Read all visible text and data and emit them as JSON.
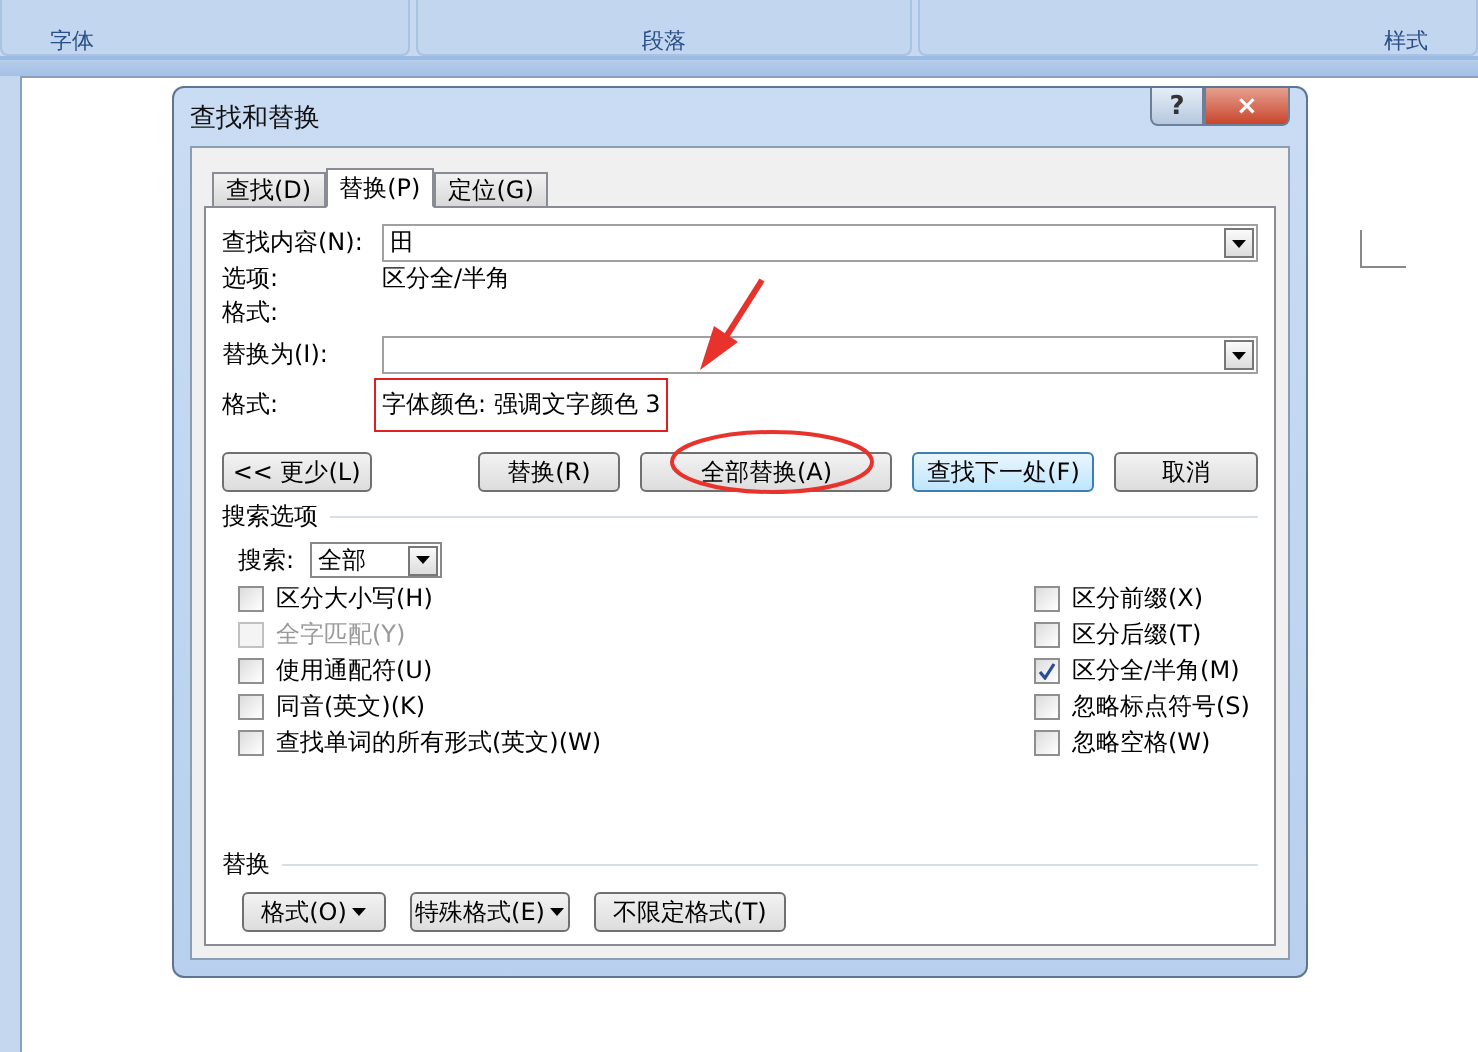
{
  "ribbon": {
    "groups": [
      "字体",
      "段落",
      "样式"
    ]
  },
  "dialog": {
    "title": "查找和替换",
    "help_button": "?",
    "close_button": "×",
    "tabs": [
      {
        "label": "查找(D)",
        "selected": false
      },
      {
        "label": "替换(P)",
        "selected": true
      },
      {
        "label": "定位(G)",
        "selected": false
      }
    ],
    "find": {
      "label": "查找内容(N):",
      "value": "田",
      "options_label": "选项:",
      "options_value": "区分全/半角",
      "format_label": "格式:"
    },
    "replace": {
      "label": "替换为(I):",
      "format_label": "格式:",
      "format_value": "字体颜色: 强调文字颜色 3"
    },
    "buttons": [
      {
        "label": "<< 更少(L)",
        "default": false
      },
      {
        "label": "替换(R)",
        "default": false
      },
      {
        "label": "全部替换(A)",
        "default": false
      },
      {
        "label": "查找下一处(F)",
        "default": true
      },
      {
        "label": "取消",
        "default": false
      }
    ],
    "search_options": {
      "heading": "搜索选项",
      "search_label": "搜索:",
      "search_value": "全部",
      "left": [
        {
          "label": "区分大小写(H)",
          "checked": false,
          "disabled": false
        },
        {
          "label": "全字匹配(Y)",
          "checked": false,
          "disabled": true
        },
        {
          "label": "使用通配符(U)",
          "checked": false,
          "disabled": false
        },
        {
          "label": "同音(英文)(K)",
          "checked": false,
          "disabled": false
        },
        {
          "label": "查找单词的所有形式(英文)(W)",
          "checked": false,
          "disabled": false
        }
      ],
      "right": [
        {
          "label": "区分前缀(X)",
          "checked": false,
          "disabled": false
        },
        {
          "label": "区分后缀(T)",
          "checked": false,
          "disabled": false
        },
        {
          "label": "区分全/半角(M)",
          "checked": true,
          "disabled": false
        },
        {
          "label": "忽略标点符号(S)",
          "checked": false,
          "disabled": false
        },
        {
          "label": "忽略空格(W)",
          "checked": false,
          "disabled": false
        }
      ]
    },
    "replace_section": {
      "heading": "替换",
      "buttons": [
        {
          "label": "格式(O)",
          "menu": true
        },
        {
          "label": "特殊格式(E)",
          "menu": true
        },
        {
          "label": "不限定格式(T)",
          "menu": false
        }
      ]
    }
  }
}
